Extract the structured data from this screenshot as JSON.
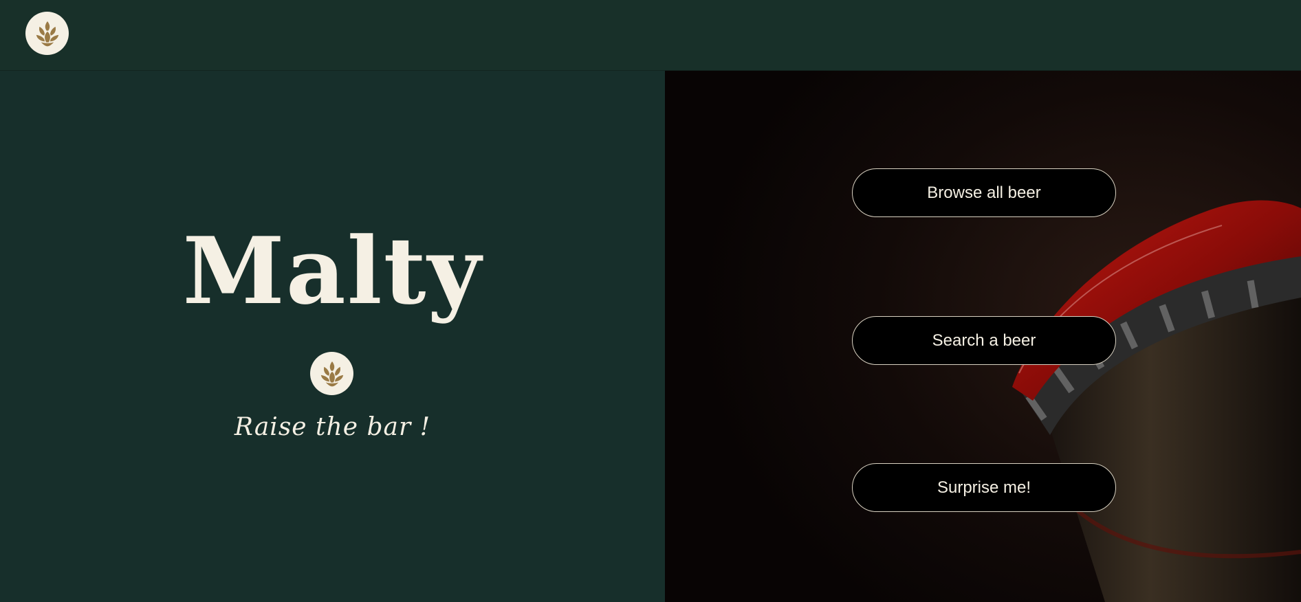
{
  "header": {
    "logo_icon": "hop-cone-icon"
  },
  "hero": {
    "title": "Malty",
    "emblem_icon": "hop-cone-icon",
    "tagline": "Raise the bar !"
  },
  "actions": {
    "browse_label": "Browse all beer",
    "search_label": "Search a beer",
    "surprise_label": "Surprise me!"
  },
  "colors": {
    "primary_green": "#172f2b",
    "cream": "#f5f0e4",
    "hop_gold": "#9a7a45",
    "dark_photo_bg": "#0b0605",
    "cap_red": "#a3100c"
  }
}
